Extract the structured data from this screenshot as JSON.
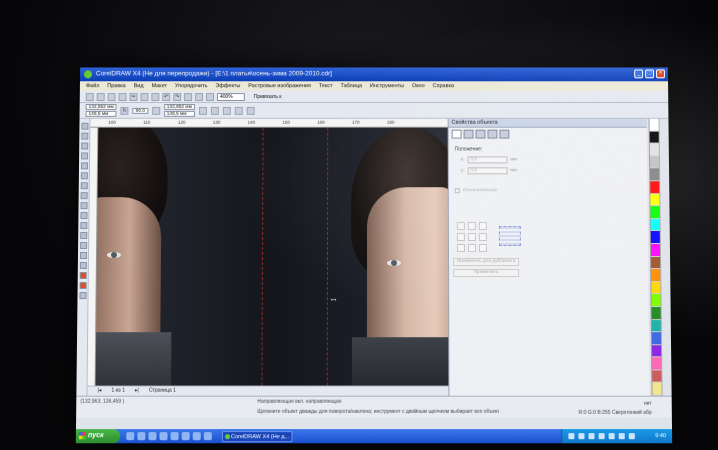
{
  "window": {
    "title": "CorelDRAW X4 (Не для перепродажи) - [E:\\1 платья\\осень-зима 2009-2010.cdr]"
  },
  "menu": [
    "Файл",
    "Правка",
    "Вид",
    "Макет",
    "Упорядочить",
    "Эффекты",
    "Растровые изображения",
    "Текст",
    "Таблица",
    "Инструменты",
    "Окно",
    "Справка"
  ],
  "toolbar": {
    "zoom": "400%",
    "snap_label": "Привязать к"
  },
  "propbar": {
    "x_value": "132,852 мм",
    "y_value": "148,5 мм",
    "w_value": "132,852 мм",
    "h_value": "148,5 мм",
    "angle": "90,0"
  },
  "ruler": {
    "ticks": [
      "100",
      "110",
      "120",
      "130",
      "140",
      "150",
      "160",
      "170",
      "180"
    ]
  },
  "pagebar": {
    "counter": "1 из 1",
    "page_tab": "Страница 1"
  },
  "docker": {
    "title": "Свойства объекта",
    "position_label": "Положение:",
    "x_label": "x:",
    "x_value": "0,0",
    "y_label": "y:",
    "y_value": "0,0",
    "unit": "мм",
    "relative_label": "Относительное",
    "apply_to_dup": "Применить для дубликата",
    "apply": "Применить"
  },
  "status": {
    "coords": "(132,963; 136,459 )",
    "hint_top": "Направляющая вкл. направляющая",
    "hint_bottom": "Щелкните объект дважды для поворота/наклона; инструмент с двойным щелчком выбирает все объекты; Shift+щелчок - выбор несколь...",
    "fill": "нет",
    "outline": "R:0 G:0 B:255  Сверхтонкий абр"
  },
  "taskbar": {
    "start": "пуск",
    "task": "CorelDRAW X4 (Не д...",
    "clock": "9:40"
  },
  "palette_colors": [
    "#ffffff",
    "#000000",
    "#e0e0e0",
    "#c0c0c0",
    "#808080",
    "#ff0000",
    "#ffff00",
    "#00ff00",
    "#00ffff",
    "#0000ff",
    "#ff00ff",
    "#a0522d",
    "#ff8c00",
    "#ffd700",
    "#7cfc00",
    "#228b22",
    "#20b2aa",
    "#4169e1",
    "#8a2be2",
    "#ff69b4",
    "#cd5c5c",
    "#f0e68c"
  ]
}
